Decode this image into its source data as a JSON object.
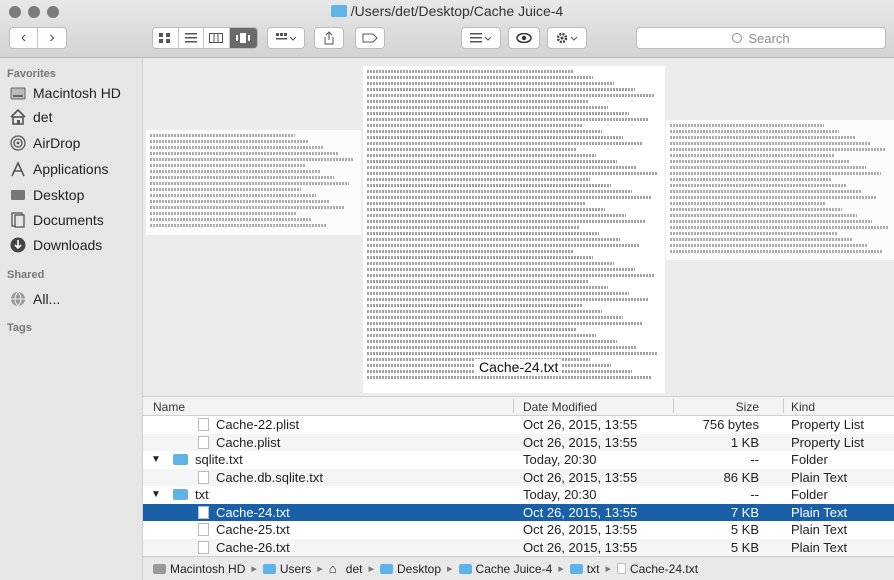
{
  "window": {
    "title": "/Users/det/Desktop/Cache Juice-4"
  },
  "toolbar": {
    "back": "‹",
    "forward": "›",
    "view_icon": "≣",
    "action_icon": "⬆",
    "tag_icon": "⬭",
    "arrange_icon": "≡",
    "eye_icon": "◉",
    "gear_icon": "✱"
  },
  "search": {
    "placeholder": "Search"
  },
  "sidebar": {
    "favorites_header": "Favorites",
    "favorites": [
      {
        "label": "Macintosh HD",
        "icon": "disk-icon"
      },
      {
        "label": "det",
        "icon": "home-icon"
      },
      {
        "label": "AirDrop",
        "icon": "airdrop-icon"
      },
      {
        "label": "Applications",
        "icon": "applications-icon"
      },
      {
        "label": "Desktop",
        "icon": "desktop-icon"
      },
      {
        "label": "Documents",
        "icon": "documents-icon"
      },
      {
        "label": "Downloads",
        "icon": "downloads-icon"
      }
    ],
    "shared_header": "Shared",
    "shared": [
      {
        "label": "All...",
        "icon": "network-icon"
      }
    ],
    "tags_header": "Tags"
  },
  "preview": {
    "cover_label": "Cache-24.txt"
  },
  "columns": {
    "name": "Name",
    "date": "Date Modified",
    "size": "Size",
    "kind": "Kind"
  },
  "rows": [
    {
      "name": "Cache-22.plist",
      "date": "Oct 26, 2015, 13:55",
      "size": "756 bytes",
      "kind": "Property List",
      "type": "file",
      "indent": 1
    },
    {
      "name": "Cache.plist",
      "date": "Oct 26, 2015, 13:55",
      "size": "1 KB",
      "kind": "Property List",
      "type": "file",
      "indent": 1
    },
    {
      "name": "sqlite.txt",
      "date": "Today, 20:30",
      "size": "--",
      "kind": "Folder",
      "type": "folder",
      "indent": 0
    },
    {
      "name": "Cache.db.sqlite.txt",
      "date": "Oct 26, 2015, 13:55",
      "size": "86 KB",
      "kind": "Plain Text",
      "type": "file",
      "indent": 1
    },
    {
      "name": "txt",
      "date": "Today, 20:30",
      "size": "--",
      "kind": "Folder",
      "type": "folder",
      "indent": 0
    },
    {
      "name": "Cache-24.txt",
      "date": "Oct 26, 2015, 13:55",
      "size": "7 KB",
      "kind": "Plain Text",
      "type": "file",
      "indent": 1,
      "selected": true
    },
    {
      "name": "Cache-25.txt",
      "date": "Oct 26, 2015, 13:55",
      "size": "5 KB",
      "kind": "Plain Text",
      "type": "file",
      "indent": 1
    },
    {
      "name": "Cache-26.txt",
      "date": "Oct 26, 2015, 13:55",
      "size": "5 KB",
      "kind": "Plain Text",
      "type": "file",
      "indent": 1
    }
  ],
  "pathbar": [
    {
      "label": "Macintosh HD",
      "icon": "disk-icon"
    },
    {
      "label": "Users",
      "icon": "folder-icon"
    },
    {
      "label": "det",
      "icon": "home-icon"
    },
    {
      "label": "Desktop",
      "icon": "folder-icon"
    },
    {
      "label": "Cache Juice-4",
      "icon": "folder-icon"
    },
    {
      "label": "txt",
      "icon": "folder-icon"
    },
    {
      "label": "Cache-24.txt",
      "icon": "file-icon"
    }
  ],
  "colors": {
    "selection": "#1960a8",
    "folder": "#5fb3e7"
  }
}
